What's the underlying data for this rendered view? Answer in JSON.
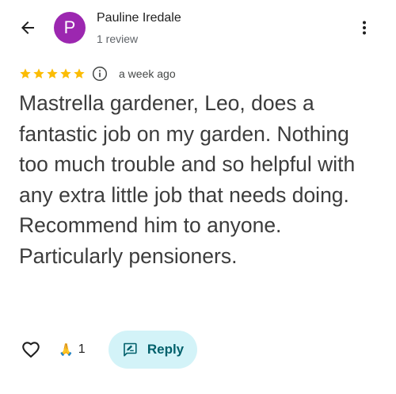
{
  "header": {
    "back_icon": "arrow-back-icon",
    "avatar_letter": "P",
    "avatar_color": "#9c27b0",
    "author_name": "Pauline Iredale",
    "author_meta": "1 review",
    "more_icon": "more-vert-icon"
  },
  "rating": {
    "stars": 5,
    "max_stars": 5,
    "star_color": "#fbbc04",
    "info_icon": "info-icon",
    "timestamp": "a week ago"
  },
  "review": {
    "text": "Mastrella gardener, Leo, does a fantastic job on my garden. Nothing too much trouble and so helpful with any extra little job that needs doing. Recommend him to anyone. Particularly pensioners."
  },
  "actions": {
    "like_icon": "heart-outline-icon",
    "reaction_emoji": "🙏",
    "reaction_count": "1",
    "reply_icon": "reply-comment-icon",
    "reply_label": "Reply",
    "reply_bg": "#d3f3f8",
    "reply_text_color": "#00606b"
  }
}
